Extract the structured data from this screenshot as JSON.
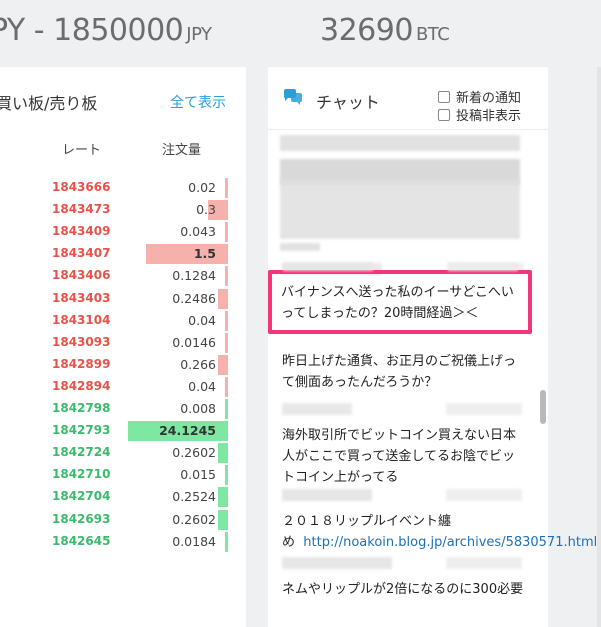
{
  "header": {
    "price_left_prefix": "PY - ",
    "price_left_value": "1850000",
    "price_left_unit": "JPY",
    "price_right_value": "32690",
    "price_right_unit": "BTC"
  },
  "book": {
    "title": "買い板/売り板",
    "show_all": "全て表示",
    "col_rate": "レート",
    "col_qty": "注文量",
    "rows": [
      {
        "rate": "1843666",
        "qty": "0.02",
        "side": "sell",
        "bar": 0.02
      },
      {
        "rate": "1843473",
        "qty": "0.3",
        "side": "sell",
        "bar": 0.2
      },
      {
        "rate": "1843409",
        "qty": "0.043",
        "side": "sell",
        "bar": 0.0
      },
      {
        "rate": "1843407",
        "qty": "1.5",
        "side": "sell",
        "bar": 0.82
      },
      {
        "rate": "1843406",
        "qty": "0.1284",
        "side": "sell",
        "bar": 0.02
      },
      {
        "rate": "1843403",
        "qty": "0.2486",
        "side": "sell",
        "bar": 0.1
      },
      {
        "rate": "1843104",
        "qty": "0.04",
        "side": "sell",
        "bar": 0.02
      },
      {
        "rate": "1843093",
        "qty": "0.0146",
        "side": "sell",
        "bar": 0.02
      },
      {
        "rate": "1842899",
        "qty": "0.266",
        "side": "sell",
        "bar": 0.1
      },
      {
        "rate": "1842894",
        "qty": "0.04",
        "side": "sell",
        "bar": 0.02
      },
      {
        "rate": "1842798",
        "qty": "0.008",
        "side": "buy",
        "bar": 0.02
      },
      {
        "rate": "1842793",
        "qty": "24.1245",
        "side": "buy",
        "bar": 1.0
      },
      {
        "rate": "1842724",
        "qty": "0.2602",
        "side": "buy",
        "bar": 0.1
      },
      {
        "rate": "1842710",
        "qty": "0.015",
        "side": "buy",
        "bar": 0.02
      },
      {
        "rate": "1842704",
        "qty": "0.2524",
        "side": "buy",
        "bar": 0.1
      },
      {
        "rate": "1842693",
        "qty": "0.2602",
        "side": "buy",
        "bar": 0.1
      },
      {
        "rate": "1842645",
        "qty": "0.0184",
        "side": "buy",
        "bar": 0.02
      }
    ]
  },
  "chat": {
    "title": "チャット",
    "opt_notify": "新着の通知",
    "opt_hide_post": "投稿非表示",
    "highlight_msg": "バイナンスへ送った私のイーサどこへいってしまったの？20時間経過＞＜",
    "msg1": "昨日上げた通貨、お正月のご祝儀上げって側面あったんだろうか？",
    "msg2": "海外取引所でビットコイン買えない日本人がここで買って送金してるお陰でビットコイン上がってる",
    "msg3_text": "２０１８リップルイベント纏め",
    "msg3_link": "http://noakoin.blog.jp/archives/5830571.html",
    "msg4": "ネムやリップルが2倍になるのに300必要"
  },
  "colors": {
    "sell": "#e8524a",
    "buy": "#3bba6b",
    "sell_bar": "#f7b1ad",
    "buy_bar": "#7ee8a2",
    "link": "#2a9fd8",
    "highlight": "#f3357a"
  }
}
